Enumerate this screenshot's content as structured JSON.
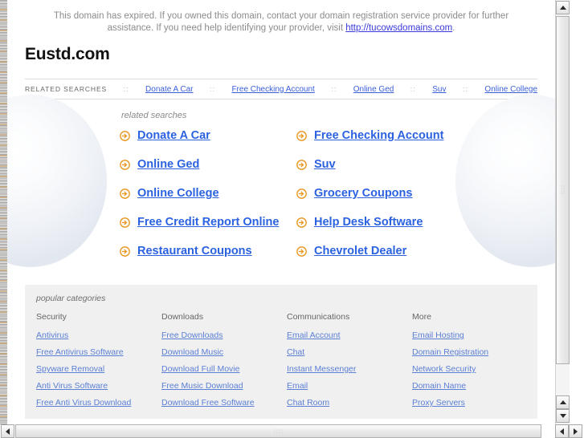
{
  "notice": {
    "text_before": "This domain has expired. If you owned this domain, contact your domain registration service provider for further assistance. If you need help identifying your provider, visit ",
    "link": "http://tucowsdomains.com",
    "text_after": "."
  },
  "site_title": "Eustd.com",
  "related_strip": {
    "label": "RELATED SEARCHES",
    "separator": "::",
    "links": [
      "Donate A Car",
      "Free Checking Account",
      "Online Ged",
      "Suv",
      "Online College"
    ]
  },
  "main": {
    "caption": "related searches",
    "icon": "arrow-circle-right-icon",
    "links": [
      "Donate A Car",
      "Free Checking Account",
      "Online Ged",
      "Suv",
      "Online College",
      "Grocery Coupons",
      "Free Credit Report Online",
      "Help Desk Software",
      "Restaurant Coupons",
      "Chevrolet Dealer"
    ]
  },
  "categories": {
    "caption": "popular categories",
    "columns": [
      {
        "heading": "Security",
        "links": [
          "Antivirus",
          "Free Antivirus Software",
          "Spyware Removal",
          "Anti Virus Software",
          "Free Anti Virus Download"
        ]
      },
      {
        "heading": "Downloads",
        "links": [
          "Free Downloads",
          "Download Music",
          "Download Full Movie",
          "Free Music Download",
          "Download Free Software"
        ]
      },
      {
        "heading": "Communications",
        "links": [
          "Email Account",
          "Chat",
          "Instant Messenger",
          "Email",
          "Chat Room"
        ]
      },
      {
        "heading": "More",
        "links": [
          "Email Hosting",
          "Domain Registration",
          "Network Security",
          "Domain Name",
          "Proxy Servers"
        ]
      }
    ]
  },
  "colors": {
    "link_blue": "#2b62e0",
    "strip_link_blue": "#3a5fd9",
    "category_link_blue": "#5b7fd4",
    "arrow_orange": "#e8941a",
    "notice_gray": "#8c8c8c",
    "categories_bg": "#f0f0f0"
  },
  "scrollbars": {
    "vertical_up": "scroll-up-arrow",
    "vertical_down": "scroll-down-arrow",
    "horizontal_left": "scroll-left-arrow",
    "horizontal_right": "scroll-right-arrow"
  }
}
